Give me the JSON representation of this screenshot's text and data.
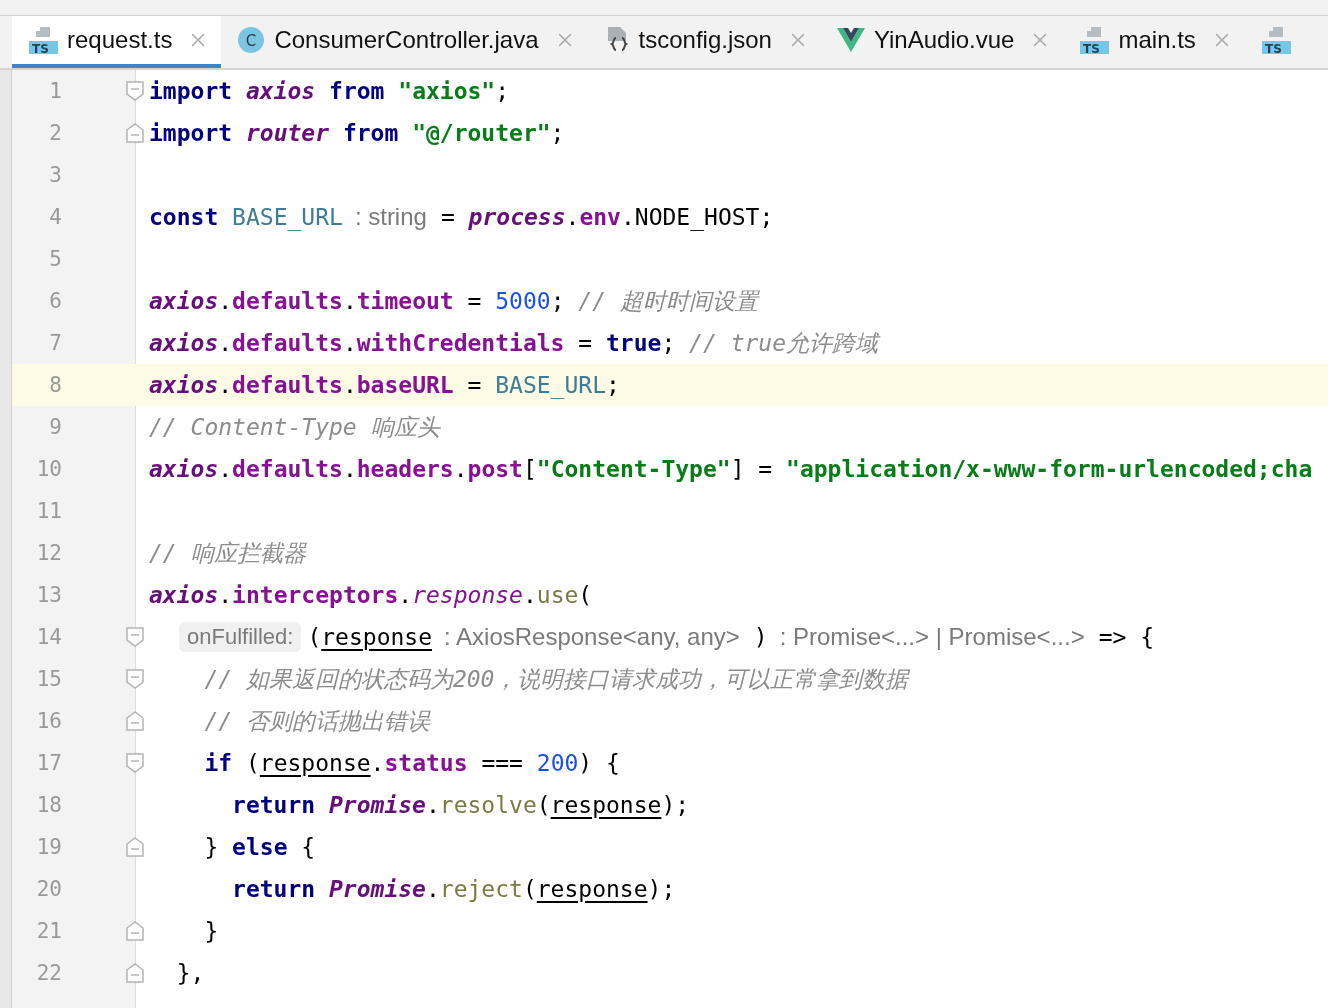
{
  "tabs": [
    {
      "label": "request.ts",
      "kind": "ts",
      "icon_label": "TS",
      "selected": true
    },
    {
      "label": "ConsumerController.java",
      "kind": "class",
      "icon_label": "C",
      "selected": false
    },
    {
      "label": "tsconfig.json",
      "kind": "json",
      "selected": false
    },
    {
      "label": "YinAudio.vue",
      "kind": "vue",
      "selected": false
    },
    {
      "label": "main.ts",
      "kind": "ts",
      "icon_label": "TS",
      "selected": false
    },
    {
      "kind": "ts",
      "icon_label": "TS",
      "selected": false
    }
  ],
  "editor": {
    "lines": [
      {
        "number": "1",
        "fold": {
          "kind": "start"
        },
        "current": false,
        "segments": [
          {
            "kind": "code",
            "tokens": [
              {
                "kind": "kw",
                "t": "import "
              },
              {
                "kind": "iv",
                "t": "axios "
              },
              {
                "kind": "kw",
                "t": "from "
              },
              {
                "kind": "str",
                "t": "\"axios\""
              },
              {
                "kind": "p",
                "t": ";"
              }
            ]
          }
        ]
      },
      {
        "number": "2",
        "fold": {
          "kind": "end"
        },
        "current": false,
        "segments": [
          {
            "kind": "code",
            "tokens": [
              {
                "kind": "kw",
                "t": "import "
              },
              {
                "kind": "iv",
                "t": "router "
              },
              {
                "kind": "kw",
                "t": "from "
              },
              {
                "kind": "str",
                "t": "\"@/router\""
              },
              {
                "kind": "p",
                "t": ";"
              }
            ]
          }
        ]
      },
      {
        "number": "3",
        "current": false
      },
      {
        "number": "4",
        "current": false,
        "segments": [
          {
            "kind": "code",
            "tokens": [
              {
                "kind": "kw",
                "t": "const "
              },
              {
                "kind": "const",
                "t": "BASE_URL"
              }
            ]
          },
          {
            "kind": "hint",
            "text": ": string"
          },
          {
            "kind": "code",
            "tokens": [
              {
                "kind": "p",
                "t": "= "
              },
              {
                "kind": "iv",
                "t": "process"
              },
              {
                "kind": "p",
                "t": "."
              },
              {
                "kind": "f",
                "t": "env"
              },
              {
                "kind": "p",
                "t": ".NODE_HOST;"
              }
            ]
          }
        ]
      },
      {
        "number": "5",
        "current": false
      },
      {
        "number": "6",
        "current": false,
        "segments": [
          {
            "kind": "code",
            "tokens": [
              {
                "kind": "iv",
                "t": "axios"
              },
              {
                "kind": "p",
                "t": "."
              },
              {
                "kind": "f",
                "t": "defaults"
              },
              {
                "kind": "p",
                "t": "."
              },
              {
                "kind": "f",
                "t": "timeout"
              },
              {
                "kind": "p",
                "t": " = "
              },
              {
                "kind": "num",
                "t": "5000"
              },
              {
                "kind": "p",
                "t": "; "
              },
              {
                "kind": "cm",
                "t": "// 超时时间设置"
              }
            ]
          }
        ]
      },
      {
        "number": "7",
        "current": false,
        "segments": [
          {
            "kind": "code",
            "tokens": [
              {
                "kind": "iv",
                "t": "axios"
              },
              {
                "kind": "p",
                "t": "."
              },
              {
                "kind": "f",
                "t": "defaults"
              },
              {
                "kind": "p",
                "t": "."
              },
              {
                "kind": "f",
                "t": "withCredentials"
              },
              {
                "kind": "p",
                "t": " = "
              },
              {
                "kind": "kw",
                "t": "true"
              },
              {
                "kind": "p",
                "t": "; "
              },
              {
                "kind": "cm",
                "t": "// true允许跨域"
              }
            ]
          }
        ]
      },
      {
        "number": "8",
        "current": true,
        "segments": [
          {
            "kind": "code",
            "tokens": [
              {
                "kind": "iv",
                "t": "axios"
              },
              {
                "kind": "p",
                "t": "."
              },
              {
                "kind": "f",
                "t": "defaults"
              },
              {
                "kind": "p",
                "t": "."
              },
              {
                "kind": "f",
                "t": "baseURL"
              },
              {
                "kind": "p",
                "t": " = "
              },
              {
                "kind": "const",
                "t": "BASE_URL"
              },
              {
                "kind": "p",
                "t": ";"
              }
            ]
          }
        ]
      },
      {
        "number": "9",
        "current": false,
        "segments": [
          {
            "kind": "code",
            "tokens": [
              {
                "kind": "cm",
                "t": "// Content-Type 响应头"
              }
            ]
          }
        ]
      },
      {
        "number": "10",
        "current": false,
        "segments": [
          {
            "kind": "code",
            "tokens": [
              {
                "kind": "iv",
                "t": "axios"
              },
              {
                "kind": "p",
                "t": "."
              },
              {
                "kind": "f",
                "t": "defaults"
              },
              {
                "kind": "p",
                "t": "."
              },
              {
                "kind": "f",
                "t": "headers"
              },
              {
                "kind": "p",
                "t": "."
              },
              {
                "kind": "f",
                "t": "post"
              },
              {
                "kind": "p",
                "t": "["
              },
              {
                "kind": "str",
                "t": "\"Content-Type\""
              },
              {
                "kind": "p",
                "t": "] = "
              },
              {
                "kind": "str",
                "t": "\"application/x-www-form-urlencoded;cha"
              }
            ]
          }
        ]
      },
      {
        "number": "11",
        "current": false
      },
      {
        "number": "12",
        "current": false,
        "segments": [
          {
            "kind": "code",
            "tokens": [
              {
                "kind": "cm",
                "t": "// 响应拦截器"
              }
            ]
          }
        ]
      },
      {
        "number": "13",
        "current": false,
        "segments": [
          {
            "kind": "code",
            "tokens": [
              {
                "kind": "iv",
                "t": "axios"
              },
              {
                "kind": "p",
                "t": "."
              },
              {
                "kind": "f",
                "t": "interceptors"
              },
              {
                "kind": "p",
                "t": "."
              },
              {
                "kind": "ip",
                "t": "response"
              },
              {
                "kind": "p",
                "t": "."
              },
              {
                "kind": "m",
                "t": "use"
              },
              {
                "kind": "p",
                "t": "("
              }
            ]
          }
        ]
      },
      {
        "number": "14",
        "fold": {
          "kind": "start"
        },
        "current": false,
        "segments": [
          {
            "kind": "label_hint",
            "text": "onFulfilled:"
          },
          {
            "kind": "code",
            "tokens": [
              {
                "kind": "p",
                "t": "("
              },
              {
                "kind": "param",
                "t": "response"
              }
            ]
          },
          {
            "kind": "hint",
            "text": ": AxiosResponse<any, any>"
          },
          {
            "kind": "code",
            "tokens": [
              {
                "kind": "p",
                "t": ")"
              }
            ]
          },
          {
            "kind": "hint",
            "text": ": Promise<...> | Promise<...>"
          },
          {
            "kind": "code",
            "tokens": [
              {
                "kind": "p",
                "t": "=> {"
              }
            ]
          }
        ]
      },
      {
        "number": "15",
        "fold": {
          "kind": "start"
        },
        "current": false,
        "segments": [
          {
            "kind": "code",
            "tokens": [
              {
                "kind": "cm",
                "t": "    // 如果返回的状态码为200，说明接口请求成功，可以正常拿到数据"
              }
            ]
          }
        ]
      },
      {
        "number": "16",
        "fold": {
          "kind": "end"
        },
        "current": false,
        "segments": [
          {
            "kind": "code",
            "tokens": [
              {
                "kind": "cm",
                "t": "    // 否则的话抛出错误"
              }
            ]
          }
        ]
      },
      {
        "number": "17",
        "fold": {
          "kind": "start"
        },
        "current": false,
        "segments": [
          {
            "kind": "code",
            "tokens": [
              {
                "kind": "kw",
                "t": "    if"
              },
              {
                "kind": "p",
                "t": " ("
              },
              {
                "kind": "param",
                "t": "response"
              },
              {
                "kind": "p",
                "t": "."
              },
              {
                "kind": "f",
                "t": "status"
              },
              {
                "kind": "p",
                "t": " === "
              },
              {
                "kind": "num",
                "t": "200"
              },
              {
                "kind": "p",
                "t": ") {"
              }
            ]
          }
        ]
      },
      {
        "number": "18",
        "current": false,
        "segments": [
          {
            "kind": "code",
            "tokens": [
              {
                "kind": "kw",
                "t": "      return "
              },
              {
                "kind": "iv",
                "t": "Promise"
              },
              {
                "kind": "p",
                "t": "."
              },
              {
                "kind": "m",
                "t": "resolve"
              },
              {
                "kind": "p",
                "t": "("
              },
              {
                "kind": "param",
                "t": "response"
              },
              {
                "kind": "p",
                "t": ");"
              }
            ]
          }
        ]
      },
      {
        "number": "19",
        "fold": {
          "kind": "end"
        },
        "current": false,
        "segments": [
          {
            "kind": "code",
            "tokens": [
              {
                "kind": "p",
                "t": "    } "
              },
              {
                "kind": "kw",
                "t": "else"
              },
              {
                "kind": "p",
                "t": " {"
              }
            ]
          }
        ]
      },
      {
        "number": "20",
        "current": false,
        "segments": [
          {
            "kind": "code",
            "tokens": [
              {
                "kind": "kw",
                "t": "      return "
              },
              {
                "kind": "iv",
                "t": "Promise"
              },
              {
                "kind": "p",
                "t": "."
              },
              {
                "kind": "m",
                "t": "reject"
              },
              {
                "kind": "p",
                "t": "("
              },
              {
                "kind": "param",
                "t": "response"
              },
              {
                "kind": "p",
                "t": ");"
              }
            ]
          }
        ]
      },
      {
        "number": "21",
        "fold": {
          "kind": "end"
        },
        "current": false,
        "segments": [
          {
            "kind": "code",
            "tokens": [
              {
                "kind": "p",
                "t": "    }"
              }
            ]
          }
        ]
      },
      {
        "number": "22",
        "fold": {
          "kind": "end"
        },
        "current": false,
        "segments": [
          {
            "kind": "code",
            "tokens": [
              {
                "kind": "p",
                "t": "  },"
              }
            ]
          }
        ]
      }
    ]
  }
}
